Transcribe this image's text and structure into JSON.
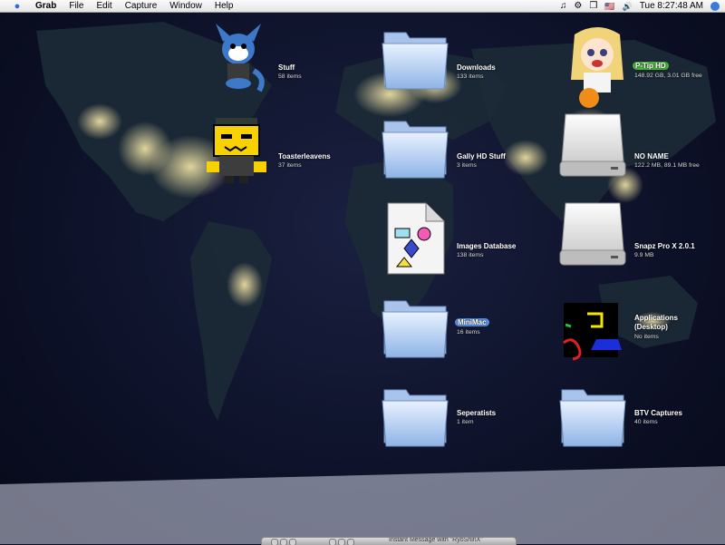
{
  "menubar": {
    "app_name": "Grab",
    "menus": [
      "File",
      "Edit",
      "Capture",
      "Window",
      "Help"
    ],
    "clock": "Tue 8:27:48 AM",
    "status_icons": [
      "music-note-icon",
      "gear-icon",
      "phone-icon",
      "flag-icon",
      "volume-icon"
    ],
    "flag": "🇺🇸",
    "music": "♫",
    "gear": "⚙",
    "volume": "🔊",
    "mini_icon": "❒"
  },
  "desktop": {
    "items": [
      {
        "name": "Stuff",
        "info": "58 items",
        "kind": "fox-character-icon"
      },
      {
        "name": "Toasterleavens",
        "info": "37 items",
        "kind": "robot-character-icon"
      },
      {
        "name": "Downloads",
        "info": "133 items",
        "kind": "folder-icon"
      },
      {
        "name": "Gally HD Stuff",
        "info": "3 items",
        "kind": "folder-icon"
      },
      {
        "name": "Images Database",
        "info": "138 items",
        "kind": "document-icon"
      },
      {
        "name": "MiniMac",
        "info": "16 items",
        "kind": "folder-icon"
      },
      {
        "name": "Seperatists",
        "info": "1 item",
        "kind": "folder-icon"
      },
      {
        "name": "P-Tip HD",
        "info": "148.92 GB, 3.01 GB free",
        "kind": "anime-character-icon"
      },
      {
        "name": "NO NAME",
        "info": "122.2 MB, 89.1 MB free",
        "kind": "drive-icon"
      },
      {
        "name": "Snapz Pro X 2.0.1",
        "info": "9.9 MB",
        "kind": "drive-icon"
      },
      {
        "name": "Applications (Desktop)",
        "info": "No items",
        "kind": "abstract-icon"
      },
      {
        "name": "BTV Captures",
        "info": "40 items",
        "kind": "folder-icon"
      }
    ]
  },
  "dock": {
    "partial_text": "Instant Message with \"RyoShinX\""
  }
}
